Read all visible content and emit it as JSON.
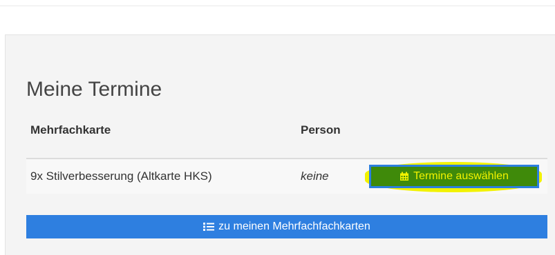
{
  "panel": {
    "title": "Meine Termine"
  },
  "table": {
    "columns": [
      "Mehrfachkarte",
      "Person"
    ],
    "rows": [
      {
        "card": "9x Stilverbesserung (Altkarte HKS)",
        "person": "keine",
        "action_label": "Termine auswählen",
        "action_icon": "calendar-icon"
      }
    ]
  },
  "footer": {
    "back_label": "zu meinen Mehrfachfachkarten",
    "back_icon": "list-icon"
  },
  "colors": {
    "panel_bg": "#f4f4f4",
    "primary_blue": "#2e7fe0",
    "select_button_bg": "#3f8a0a",
    "select_button_text": "#f2f200",
    "highlight": "#f2f200"
  }
}
